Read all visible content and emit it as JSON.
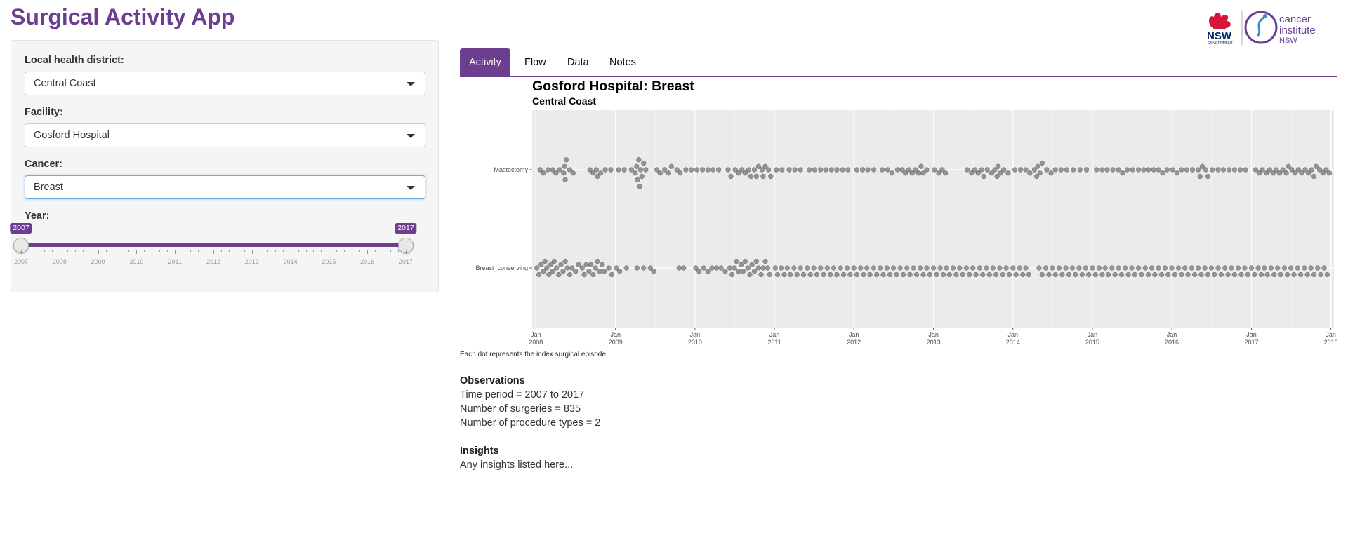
{
  "app": {
    "title": "Surgical Activity App",
    "brand_color": "#6b3e8f",
    "logos": {
      "nsw_text": "NSW",
      "nsw_sub": "GOVERNMENT",
      "ci_line1": "cancer",
      "ci_line2": "institute",
      "ci_line3": "NSW"
    }
  },
  "sidebar": {
    "lhd": {
      "label": "Local health district:",
      "value": "Central Coast"
    },
    "facility": {
      "label": "Facility:",
      "value": "Gosford Hospital"
    },
    "cancer": {
      "label": "Cancer:",
      "value": "Breast"
    },
    "year": {
      "label": "Year:",
      "min": 2007,
      "max": 2017,
      "from": 2007,
      "to": 2017,
      "from_label": "2007",
      "to_label": "2017",
      "ticks": [
        "2007",
        "2008",
        "2009",
        "2010",
        "2011",
        "2012",
        "2013",
        "2014",
        "2015",
        "2016",
        "2017"
      ]
    }
  },
  "tabs": [
    {
      "label": "Activity",
      "active": true
    },
    {
      "label": "Flow",
      "active": false
    },
    {
      "label": "Data",
      "active": false
    },
    {
      "label": "Notes",
      "active": false
    }
  ],
  "chart_data": {
    "type": "scatter",
    "title": "Gosford Hospital: Breast",
    "subtitle": "Central Coast",
    "categories": [
      "Mastectomy",
      "Breast_conserving"
    ],
    "x_range": [
      "2007-12-15",
      "2018-01-15"
    ],
    "x_ticks": [
      {
        "date": "2008-01-01",
        "line1": "Jan",
        "line2": "2008"
      },
      {
        "date": "2009-01-01",
        "line1": "Jan",
        "line2": "2009"
      },
      {
        "date": "2010-01-01",
        "line1": "Jan",
        "line2": "2010"
      },
      {
        "date": "2011-01-01",
        "line1": "Jan",
        "line2": "2011"
      },
      {
        "date": "2012-01-01",
        "line1": "Jan",
        "line2": "2012"
      },
      {
        "date": "2013-01-01",
        "line1": "Jan",
        "line2": "2013"
      },
      {
        "date": "2014-01-01",
        "line1": "Jan",
        "line2": "2014"
      },
      {
        "date": "2015-01-01",
        "line1": "Jan",
        "line2": "2015"
      },
      {
        "date": "2016-01-01",
        "line1": "Jan",
        "line2": "2016"
      },
      {
        "date": "2017-01-01",
        "line1": "Jan",
        "line2": "2017"
      },
      {
        "date": "2018-01-01",
        "line1": "Jan",
        "line2": "2018"
      }
    ],
    "grid": true,
    "panel_color": "#ebebeb",
    "point_color": "#595959",
    "series": [
      {
        "category": "Mastectomy",
        "dates": [
          "2008-01-20",
          "2008-02-05",
          "2008-02-25",
          "2008-03-18",
          "2008-04-02",
          "2008-04-20",
          "2008-05-08",
          "2008-05-12",
          "2008-05-15",
          "2008-05-20",
          "2008-06-04",
          "2008-06-20",
          "2008-09-05",
          "2008-09-20",
          "2008-10-05",
          "2008-10-10",
          "2008-10-25",
          "2008-11-15",
          "2008-12-10",
          "2009-01-15",
          "2009-02-10",
          "2009-03-15",
          "2009-04-02",
          "2009-04-08",
          "2009-04-12",
          "2009-04-18",
          "2009-04-22",
          "2009-04-26",
          "2009-05-02",
          "2009-05-10",
          "2009-05-20",
          "2009-07-10",
          "2009-07-25",
          "2009-08-15",
          "2009-09-02",
          "2009-09-15",
          "2009-10-10",
          "2009-10-25",
          "2009-11-20",
          "2009-12-15",
          "2010-01-10",
          "2010-02-05",
          "2010-03-02",
          "2010-03-25",
          "2010-04-20",
          "2010-06-02",
          "2010-06-15",
          "2010-07-05",
          "2010-07-20",
          "2010-08-05",
          "2010-08-20",
          "2010-09-05",
          "2010-09-15",
          "2010-10-01",
          "2010-10-10",
          "2010-10-20",
          "2010-11-05",
          "2010-11-10",
          "2010-11-20",
          "2010-12-05",
          "2010-12-15",
          "2011-01-10",
          "2011-02-05",
          "2011-03-10",
          "2011-04-05",
          "2011-05-01",
          "2011-06-10",
          "2011-07-05",
          "2011-08-01",
          "2011-08-25",
          "2011-09-20",
          "2011-10-15",
          "2011-11-10",
          "2011-12-05",
          "2012-01-15",
          "2012-02-10",
          "2012-03-05",
          "2012-04-02",
          "2012-05-10",
          "2012-06-05",
          "2012-06-25",
          "2012-07-20",
          "2012-08-10",
          "2012-08-25",
          "2012-09-10",
          "2012-09-25",
          "2012-10-10",
          "2012-10-25",
          "2012-11-05",
          "2012-11-15",
          "2012-12-01",
          "2013-01-05",
          "2013-01-25",
          "2013-02-10",
          "2013-02-25",
          "2013-06-05",
          "2013-06-25",
          "2013-07-10",
          "2013-07-25",
          "2013-08-10",
          "2013-08-20",
          "2013-09-05",
          "2013-09-25",
          "2013-10-10",
          "2013-10-20",
          "2013-10-25",
          "2013-11-05",
          "2013-11-20",
          "2013-12-10",
          "2014-01-10",
          "2014-02-05",
          "2014-03-01",
          "2014-03-20",
          "2014-04-10",
          "2014-04-20",
          "2014-04-25",
          "2014-05-05",
          "2014-05-15",
          "2014-06-05",
          "2014-06-25",
          "2014-07-15",
          "2014-08-10",
          "2014-09-05",
          "2014-10-05",
          "2014-11-05",
          "2014-12-05",
          "2015-01-20",
          "2015-02-15",
          "2015-03-10",
          "2015-04-05",
          "2015-05-01",
          "2015-05-20",
          "2015-06-10",
          "2015-07-05",
          "2015-08-01",
          "2015-08-25",
          "2015-09-15",
          "2015-10-10",
          "2015-11-01",
          "2015-11-20",
          "2015-12-10",
          "2016-01-05",
          "2016-01-25",
          "2016-02-15",
          "2016-03-10",
          "2016-04-05",
          "2016-05-01",
          "2016-05-10",
          "2016-05-20",
          "2016-06-05",
          "2016-06-15",
          "2016-07-05",
          "2016-08-01",
          "2016-08-25",
          "2016-09-20",
          "2016-10-15",
          "2016-11-10",
          "2016-12-05",
          "2017-01-20",
          "2017-02-05",
          "2017-02-20",
          "2017-03-10",
          "2017-03-25",
          "2017-04-10",
          "2017-04-25",
          "2017-05-10",
          "2017-05-25",
          "2017-06-10",
          "2017-06-20",
          "2017-07-05",
          "2017-07-20",
          "2017-08-05",
          "2017-08-20",
          "2017-09-05",
          "2017-09-20",
          "2017-10-05",
          "2017-10-15",
          "2017-10-25",
          "2017-11-10",
          "2017-11-25",
          "2017-12-10",
          "2017-12-25"
        ]
      },
      {
        "category": "Breast_conserving",
        "dates": [
          "2008-01-05",
          "2008-01-15",
          "2008-01-25",
          "2008-02-05",
          "2008-02-12",
          "2008-02-20",
          "2008-03-01",
          "2008-03-10",
          "2008-03-18",
          "2008-03-25",
          "2008-04-05",
          "2008-04-15",
          "2008-04-25",
          "2008-05-05",
          "2008-05-15",
          "2008-05-25",
          "2008-06-05",
          "2008-06-15",
          "2008-07-01",
          "2008-07-15",
          "2008-08-01",
          "2008-08-10",
          "2008-08-20",
          "2008-09-01",
          "2008-09-10",
          "2008-09-20",
          "2008-10-01",
          "2008-10-10",
          "2008-10-20",
          "2008-11-01",
          "2008-11-10",
          "2008-12-01",
          "2008-12-15",
          "2009-01-05",
          "2009-01-20",
          "2009-02-20",
          "2009-04-10",
          "2009-05-10",
          "2009-06-10",
          "2009-06-25",
          "2009-10-20",
          "2009-11-10",
          "2010-01-05",
          "2010-01-20",
          "2010-02-10",
          "2010-03-01",
          "2010-03-20",
          "2010-04-10",
          "2010-05-01",
          "2010-05-20",
          "2010-06-10",
          "2010-06-20",
          "2010-07-01",
          "2010-07-10",
          "2010-07-20",
          "2010-08-01",
          "2010-08-10",
          "2010-08-20",
          "2010-09-01",
          "2010-09-10",
          "2010-09-20",
          "2010-10-01",
          "2010-10-10",
          "2010-10-20",
          "2010-11-01",
          "2010-11-10",
          "2010-11-20",
          "2010-12-01",
          "2010-12-10",
          "2011-01-05",
          "2011-01-15",
          "2011-02-01",
          "2011-02-15",
          "2011-03-01",
          "2011-03-15",
          "2011-04-01",
          "2011-04-15",
          "2011-05-01",
          "2011-05-15",
          "2011-06-01",
          "2011-06-15",
          "2011-07-01",
          "2011-07-15",
          "2011-08-01",
          "2011-08-15",
          "2011-09-01",
          "2011-09-15",
          "2011-10-01",
          "2011-10-15",
          "2011-11-01",
          "2011-11-15",
          "2011-12-01",
          "2011-12-15",
          "2012-01-01",
          "2012-01-15",
          "2012-02-01",
          "2012-02-15",
          "2012-03-01",
          "2012-03-15",
          "2012-04-01",
          "2012-04-15",
          "2012-05-01",
          "2012-05-15",
          "2012-06-01",
          "2012-06-15",
          "2012-07-01",
          "2012-07-15",
          "2012-08-01",
          "2012-08-15",
          "2012-09-01",
          "2012-09-15",
          "2012-10-01",
          "2012-10-15",
          "2012-11-01",
          "2012-11-15",
          "2012-12-01",
          "2012-12-15",
          "2013-01-01",
          "2013-01-15",
          "2013-02-01",
          "2013-02-15",
          "2013-03-01",
          "2013-03-15",
          "2013-04-01",
          "2013-04-15",
          "2013-05-01",
          "2013-05-15",
          "2013-06-01",
          "2013-06-15",
          "2013-07-01",
          "2013-07-15",
          "2013-08-01",
          "2013-08-15",
          "2013-09-01",
          "2013-09-15",
          "2013-10-01",
          "2013-10-15",
          "2013-11-01",
          "2013-11-15",
          "2013-12-01",
          "2013-12-15",
          "2014-01-01",
          "2014-01-15",
          "2014-02-01",
          "2014-02-15",
          "2014-03-01",
          "2014-03-15",
          "2014-05-01",
          "2014-05-15",
          "2014-06-01",
          "2014-06-15",
          "2014-07-01",
          "2014-07-15",
          "2014-08-01",
          "2014-08-15",
          "2014-09-01",
          "2014-09-15",
          "2014-10-01",
          "2014-10-15",
          "2014-11-01",
          "2014-11-15",
          "2014-12-01",
          "2014-12-15",
          "2015-01-01",
          "2015-01-15",
          "2015-02-01",
          "2015-02-15",
          "2015-03-01",
          "2015-03-15",
          "2015-04-01",
          "2015-04-15",
          "2015-05-01",
          "2015-05-15",
          "2015-06-01",
          "2015-06-15",
          "2015-07-01",
          "2015-07-15",
          "2015-08-01",
          "2015-08-15",
          "2015-09-01",
          "2015-09-15",
          "2015-10-01",
          "2015-10-15",
          "2015-11-01",
          "2015-11-15",
          "2015-12-01",
          "2015-12-15",
          "2016-01-01",
          "2016-01-15",
          "2016-02-01",
          "2016-02-15",
          "2016-03-01",
          "2016-03-15",
          "2016-04-01",
          "2016-04-15",
          "2016-05-01",
          "2016-05-15",
          "2016-06-01",
          "2016-06-15",
          "2016-07-01",
          "2016-07-15",
          "2016-08-01",
          "2016-08-15",
          "2016-09-01",
          "2016-09-15",
          "2016-10-01",
          "2016-10-15",
          "2016-11-01",
          "2016-11-15",
          "2016-12-01",
          "2016-12-15",
          "2017-01-01",
          "2017-01-15",
          "2017-02-01",
          "2017-02-15",
          "2017-03-01",
          "2017-03-15",
          "2017-04-01",
          "2017-04-15",
          "2017-05-01",
          "2017-05-15",
          "2017-06-01",
          "2017-06-15",
          "2017-07-01",
          "2017-07-15",
          "2017-08-01",
          "2017-08-15",
          "2017-09-01",
          "2017-09-15",
          "2017-10-01",
          "2017-10-15",
          "2017-11-01",
          "2017-11-15",
          "2017-12-01",
          "2017-12-15"
        ]
      }
    ]
  },
  "caption": "Each dot represents the index surgical episode",
  "observations": {
    "heading": "Observations",
    "lines": [
      "Time period = 2007 to 2017",
      "Number of surgeries = 835",
      "Number of procedure types = 2"
    ]
  },
  "insights": {
    "heading": "Insights",
    "text": "Any insights listed here..."
  }
}
